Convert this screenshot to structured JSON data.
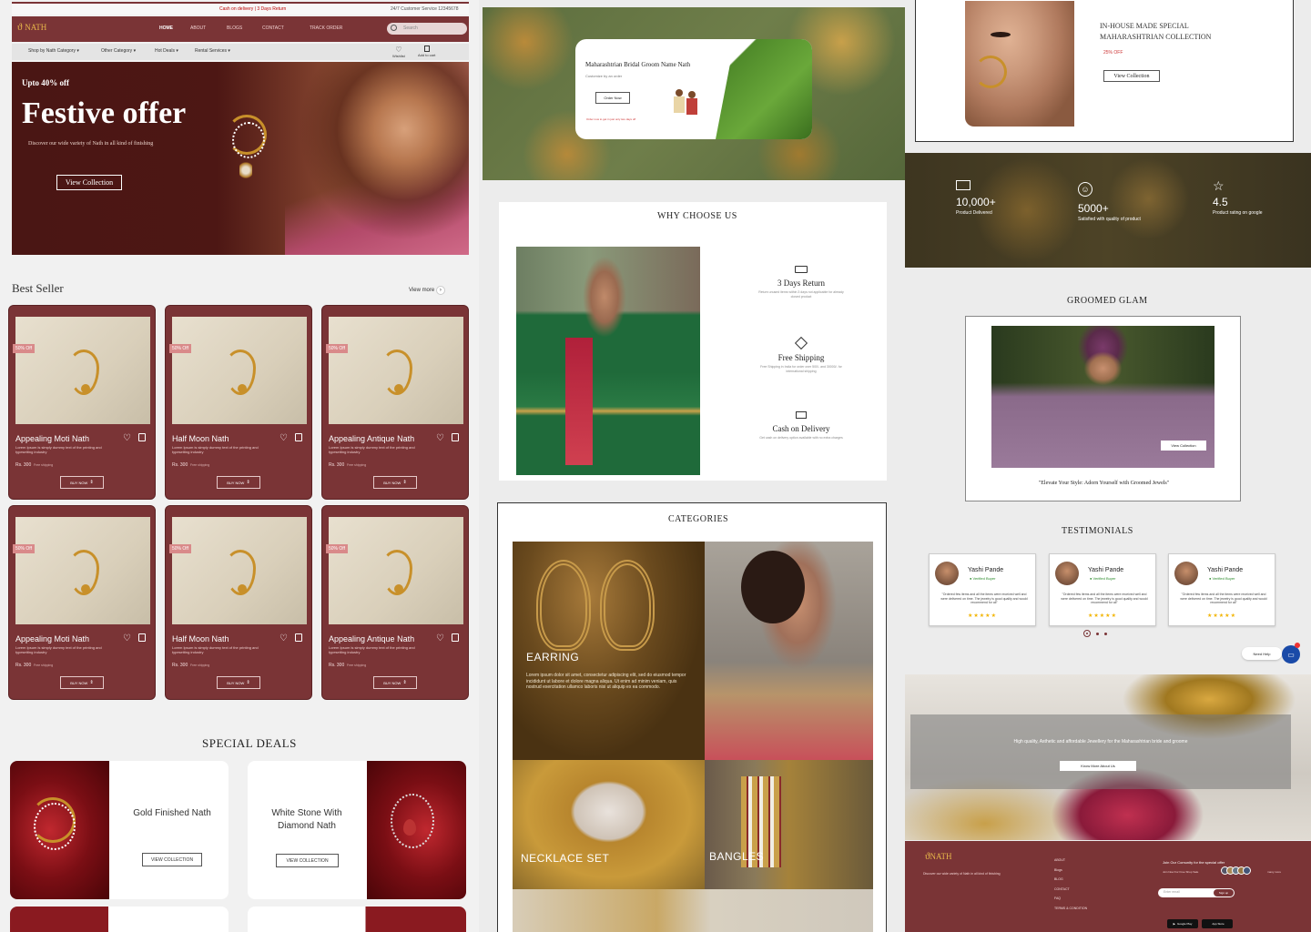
{
  "topbar": {
    "cod": "Cash on delivery | 3 Days Return",
    "service": "24/7 Customer Service 12345678"
  },
  "brand": {
    "logo_text": "NATH"
  },
  "nav": {
    "items": [
      "HOME",
      "ABOUT",
      "BLOGS",
      "CONTACT",
      "TRACK ORDER"
    ],
    "search_placeholder": "Search"
  },
  "subnav": {
    "items": [
      "Shop by Nath Category",
      "Other Category",
      "Hot Deals",
      "Rental Services"
    ],
    "wishlist": "Wishlist",
    "cart": "Add to cart"
  },
  "hero": {
    "kicker": "Upto 40% off",
    "title": "Festive offer",
    "desc": "Discover our wide variety of Nath in all kind of finishing",
    "cta": "View Collection"
  },
  "bestseller": {
    "title": "Best Seller",
    "view_more": "View more",
    "products": [
      {
        "badge": "50% Off",
        "name": "Appealing Moti Nath",
        "desc": "Lorem Ipsum is simply dummy text of the printing and typesetting industry",
        "price": "Rs. 300",
        "shipping": "Free shipping",
        "buy": "BUY NOW"
      },
      {
        "badge": "50% Off",
        "name": "Half Moon Nath",
        "desc": "Lorem Ipsum is simply dummy text of the printing and typesetting industry",
        "price": "Rs. 300",
        "shipping": "Free shipping",
        "buy": "BUY NOW"
      },
      {
        "badge": "50% Off",
        "name": "Appealing Antique Nath",
        "desc": "Lorem Ipsum is simply dummy text of the printing and typesetting industry",
        "price": "Rs. 300",
        "shipping": "Free shipping",
        "buy": "BUY NOW"
      },
      {
        "badge": "50% Off",
        "name": "Appealing Moti Nath",
        "desc": "Lorem Ipsum is simply dummy text of the printing and typesetting industry",
        "price": "Rs. 300",
        "shipping": "Free shipping",
        "buy": "BUY NOW"
      },
      {
        "badge": "50% Off",
        "name": "Half Moon Nath",
        "desc": "Lorem Ipsum is simply dummy text of the printing and typesetting industry",
        "price": "Rs. 300",
        "shipping": "Free shipping",
        "buy": "BUY NOW"
      },
      {
        "badge": "50% Off",
        "name": "Appealing Antique Nath",
        "desc": "Lorem Ipsum is simply dummy text of the printing and typesetting industry",
        "price": "Rs. 300",
        "shipping": "Free shipping",
        "buy": "BUY NOW"
      }
    ]
  },
  "deals": {
    "title": "SPECIAL DEALS",
    "items": [
      {
        "name": "Gold Finished Nath",
        "cta": "VIEW COLLECTION"
      },
      {
        "name": "White Stone With Diamond Nath",
        "cta": "VIEW COLLECTION"
      }
    ]
  },
  "groom_banner": {
    "title": "Maharashtrian Bridal Groom Name Nath",
    "sub": "Customize by an order",
    "cta": "Order Now",
    "note": "Order now to get in just only two days off"
  },
  "why": {
    "title": "WHY CHOOSE US",
    "items": [
      {
        "title": "3 Days Return",
        "desc": "Return unused items within 3 days not applicable for already closed product"
      },
      {
        "title": "Free Shipping",
        "desc": "Free Shipping in India for order over 500/- and 30000/- for international shipping"
      },
      {
        "title": "Cash on Delivery",
        "desc": "Get cash on delivery option available with no extra charges"
      }
    ]
  },
  "categories": {
    "title": "CATEGORIES",
    "earring": {
      "label": "EARRING",
      "desc": "Lorem ipsum dolor sit amet, consectetur adipiscing elit, sed do eiusmod tempor incididunt ut labore et dolore magna aliqua. Ut enim ad minim veniam, quis nostrud exercitation ullamco laboris nisi ut aliquip ex ea commodo."
    },
    "necklace": "NECKLACE SET",
    "bangles": "BANGLES"
  },
  "inhouse": {
    "title": "IN-HOUSE MADE SPECIAL MAHARASHTRIAN COLLECTION",
    "off": "25% OFF",
    "cta": "View Collection"
  },
  "stats": [
    {
      "value": "10,000+",
      "label": "Product Delivered",
      "icon": "truck-icon"
    },
    {
      "value": "5000+",
      "label": "Satisfied with quality of product",
      "icon": "smile-icon"
    },
    {
      "value": "4.5",
      "label": "Product rating on google",
      "icon": "star-icon"
    }
  ],
  "groomed": {
    "title": "GROOMED GLAM",
    "cta": "View Collection",
    "quote": "\"Elevate Your Style: Adorn Yourself with Groomed Jewels\""
  },
  "testimonials": {
    "title": "TESTIMONIALS",
    "items": [
      {
        "name": "Yashi Pande",
        "verified": "Verified Buyer",
        "text": "\"Ordered few items and all the items were received well and were delivered on time. The jewelry is good quality and would recommend for all\""
      },
      {
        "name": "Yashi Pande",
        "verified": "Verified Buyer",
        "text": "\"Ordered few items and all the items were received well and were delivered on time. The jewelry is good quality and would recommend for all\""
      },
      {
        "name": "Yashi Pande",
        "verified": "Verified Buyer",
        "text": "\"Ordered few items and all the items were received well and were delivered on time. The jewelry is good quality and would recommend for all\""
      }
    ]
  },
  "chat": {
    "label": "Need Help"
  },
  "about": {
    "text": "High quality, Asthetic and affordable Jewellery for the Maharashtrian bride and groome",
    "cta": "Know More About Us"
  },
  "footer": {
    "desc": "Discover our wide variety of Nath in all kind of finishing",
    "links": [
      "ABOUT",
      "Blogs",
      "BLOG",
      "CONTACT",
      "FAQ",
      "TERMS & CONDITION"
    ],
    "join": "Join Our Comunity for the special offer",
    "join_sub": "Join Now For Free Shop Sale",
    "members": "many more",
    "email_placeholder": "Enter email",
    "signup": "Sign up",
    "gplay": "Google Play",
    "appstore": "App Store"
  },
  "colors": {
    "maroon": "#7a3436",
    "gold": "#c8902a"
  }
}
